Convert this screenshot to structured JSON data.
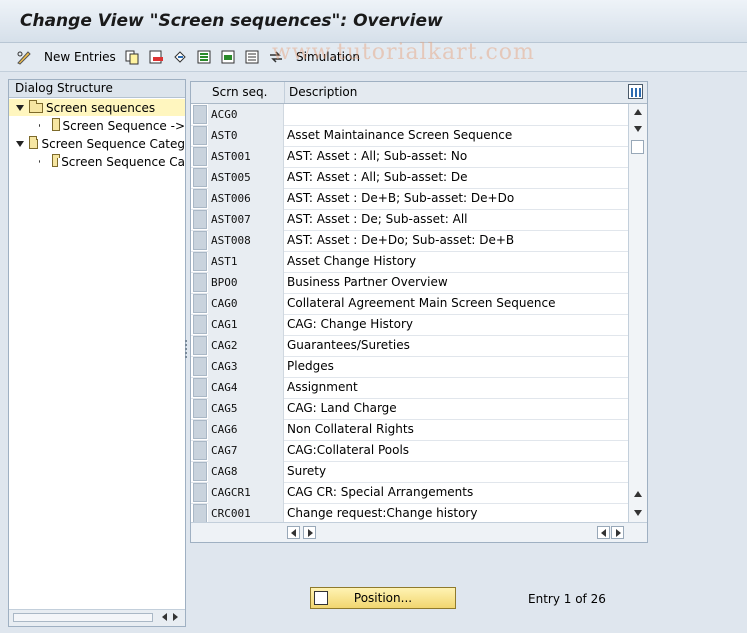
{
  "title": "Change View \"Screen sequences\": Overview",
  "toolbar": {
    "new_entries": "New Entries",
    "simulation": "Simulation"
  },
  "watermark": "www.tutorialkart.com",
  "dialog": {
    "header": "Dialog Structure",
    "items": [
      {
        "label": "Screen sequences",
        "level": 0,
        "selected": true
      },
      {
        "label": "Screen Sequence ->",
        "level": 1,
        "selected": false
      },
      {
        "label": "Screen Sequence Categ",
        "level": 0,
        "selected": false
      },
      {
        "label": "Screen Sequence Ca",
        "level": 1,
        "selected": false
      }
    ]
  },
  "table": {
    "columns": [
      "Scrn seq.",
      "Description"
    ],
    "rows": [
      {
        "key": "ACG0",
        "desc": ""
      },
      {
        "key": "AST0",
        "desc": "Asset Maintainance Screen Sequence"
      },
      {
        "key": "AST001",
        "desc": "AST: Asset : All; Sub-asset: No"
      },
      {
        "key": "AST005",
        "desc": "AST: Asset : All; Sub-asset: De"
      },
      {
        "key": "AST006",
        "desc": "AST: Asset : De+B; Sub-asset: De+Do"
      },
      {
        "key": "AST007",
        "desc": "AST: Asset : De; Sub-asset: All"
      },
      {
        "key": "AST008",
        "desc": "AST: Asset : De+Do; Sub-asset: De+B"
      },
      {
        "key": "AST1",
        "desc": "Asset Change History"
      },
      {
        "key": "BPO0",
        "desc": "Business Partner Overview"
      },
      {
        "key": "CAG0",
        "desc": "Collateral Agreement Main Screen Sequence"
      },
      {
        "key": "CAG1",
        "desc": "CAG: Change History"
      },
      {
        "key": "CAG2",
        "desc": "Guarantees/Sureties"
      },
      {
        "key": "CAG3",
        "desc": "Pledges"
      },
      {
        "key": "CAG4",
        "desc": "Assignment"
      },
      {
        "key": "CAG5",
        "desc": "CAG: Land Charge"
      },
      {
        "key": "CAG6",
        "desc": "Non Collateral Rights"
      },
      {
        "key": "CAG7",
        "desc": "CAG:Collateral Pools"
      },
      {
        "key": "CAG8",
        "desc": "Surety"
      },
      {
        "key": "CAGCR1",
        "desc": "CAG CR: Special Arrangements"
      },
      {
        "key": "CRC001",
        "desc": "Change request:Change history"
      }
    ]
  },
  "position_button": "Position...",
  "entry_info": "Entry 1 of 26",
  "colors": {
    "accent": "#f1d670",
    "selected_tree": "#fff6bf"
  }
}
